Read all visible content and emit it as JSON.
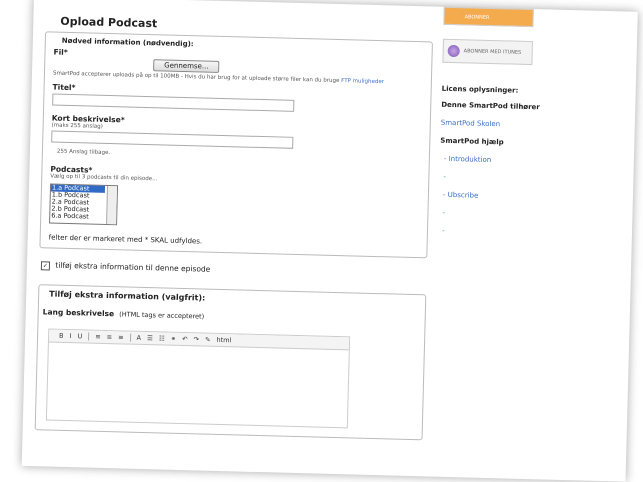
{
  "page_title": "Opload Podcast",
  "required": {
    "heading": "Nødved information (nødvendig):",
    "file_label": "Fil*",
    "browse_button": "Gennemse...",
    "file_help": "SmartPod accepterer uploads på op til 100MB - Hvis du har brug for at uploade større filer kan du bruge",
    "file_help_link": "FTP muligheder",
    "title_label": "Titel*",
    "short_desc_label": "Kort beskrivelse*",
    "short_desc_hint": "(maks 255 anslag)",
    "chars_left": "255 Anslag tilbage.",
    "podcasts_label": "Podcasts*",
    "podcasts_hint": "Vælg op til 3 podcasts til din episode...",
    "podcast_options": [
      "1.a Podcast",
      "1.b Podcast",
      "2.a Podcast",
      "2.b Podcast",
      "6.a Podcast"
    ],
    "required_note": "felter der er markeret med * SKAL udfyldes."
  },
  "extra_checkbox_label": "tilføj ekstra information til denne episode",
  "optional": {
    "heading": "Tilføj ekstra information (valgfrit):",
    "long_desc_label": "Lang beskrivelse",
    "long_desc_hint": "(HTML tags er accepteret)",
    "toolbar": [
      "B",
      "I",
      "U",
      "≡",
      "≡",
      "≡",
      "A",
      "☰",
      "☷",
      "⚭",
      "↶",
      "↷",
      "✎",
      "html"
    ]
  },
  "sidebar": {
    "rss_badge": "ABONNER",
    "itunes_badge": "ABONNER MED ITUNES",
    "license_heading": "Licens oplysninger:",
    "owner_text": "Denne SmartPod tilhører",
    "school_link": "SmartPod Skolen",
    "help_heading": "SmartPod hjælp",
    "help_links": [
      "- Introduktion",
      "-",
      "- Ubscribe",
      "-",
      "-"
    ]
  }
}
